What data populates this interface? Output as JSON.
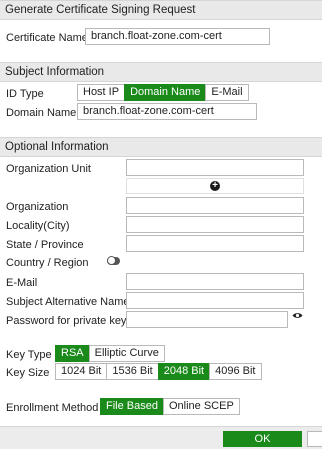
{
  "dialog": {
    "title": "Generate Certificate Signing Request"
  },
  "certificate": {
    "label": "Certificate Name",
    "value": "branch.float-zone.com-cert"
  },
  "subject": {
    "header": "Subject Information",
    "id_type": {
      "label": "ID Type",
      "options": [
        "Host IP",
        "Domain Name",
        "E-Mail"
      ],
      "selected": "Domain Name"
    },
    "domain_name": {
      "label": "Domain Name",
      "value": "branch.float-zone.com-cert"
    }
  },
  "optional": {
    "header": "Optional Information",
    "org_unit": {
      "label": "Organization Unit",
      "value": ""
    },
    "organization": {
      "label": "Organization",
      "value": ""
    },
    "locality": {
      "label": "Locality(City)",
      "value": ""
    },
    "state": {
      "label": "State / Province",
      "value": ""
    },
    "country": {
      "label": "Country / Region",
      "enabled": false
    },
    "email": {
      "label": "E-Mail",
      "value": ""
    },
    "san": {
      "label": "Subject Alternative Name",
      "value": ""
    },
    "password": {
      "label": "Password for private key",
      "value": ""
    }
  },
  "key": {
    "type": {
      "label": "Key Type",
      "options": [
        "RSA",
        "Elliptic Curve"
      ],
      "selected": "RSA"
    },
    "size": {
      "label": "Key Size",
      "options": [
        "1024 Bit",
        "1536 Bit",
        "2048 Bit",
        "4096 Bit"
      ],
      "selected": "2048 Bit"
    }
  },
  "enrollment": {
    "label": "Enrollment Method",
    "options": [
      "File Based",
      "Online SCEP"
    ],
    "selected": "File Based"
  },
  "footer": {
    "ok_label": "OK"
  },
  "icons": {
    "add": "plus-circle-icon",
    "reveal": "eye-icon",
    "toggle": "toggle-switch"
  }
}
